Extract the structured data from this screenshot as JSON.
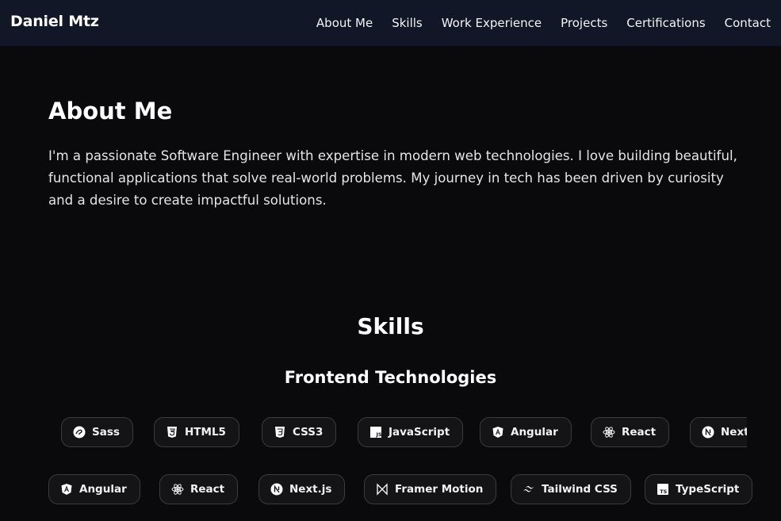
{
  "nav": {
    "brand": "Daniel Mtz",
    "links": [
      "About Me",
      "Skills",
      "Work Experience",
      "Projects",
      "Certifications",
      "Contact"
    ]
  },
  "about": {
    "title": "About Me",
    "text": "I'm a passionate Software Engineer with expertise in modern web technologies. I love building beautiful, functional applications that solve real-world problems. My journey in tech has been driven by curiosity and a desire to create impactful solutions."
  },
  "skills": {
    "title": "Skills",
    "category": "Frontend Technologies",
    "row1": [
      {
        "label": "Sass",
        "icon": "sass-icon"
      },
      {
        "label": "HTML5",
        "icon": "html5-icon"
      },
      {
        "label": "CSS3",
        "icon": "css3-icon"
      },
      {
        "label": "JavaScript",
        "icon": "javascript-icon"
      },
      {
        "label": "Angular",
        "icon": "angular-icon"
      },
      {
        "label": "React",
        "icon": "react-icon"
      },
      {
        "label": "Next.js",
        "icon": "nextjs-icon"
      }
    ],
    "row2": [
      {
        "label": "Angular",
        "icon": "angular-icon"
      },
      {
        "label": "React",
        "icon": "react-icon"
      },
      {
        "label": "Next.js",
        "icon": "nextjs-icon"
      },
      {
        "label": "Framer Motion",
        "icon": "framer-motion-icon"
      },
      {
        "label": "Tailwind CSS",
        "icon": "tailwind-icon"
      },
      {
        "label": "TypeScript",
        "icon": "typescript-icon"
      }
    ]
  },
  "colors": {
    "nav_bg": "#111726",
    "page_bg": "#0a0a0c",
    "pill_bg": "#141417",
    "pill_border": "#3a3a40"
  }
}
